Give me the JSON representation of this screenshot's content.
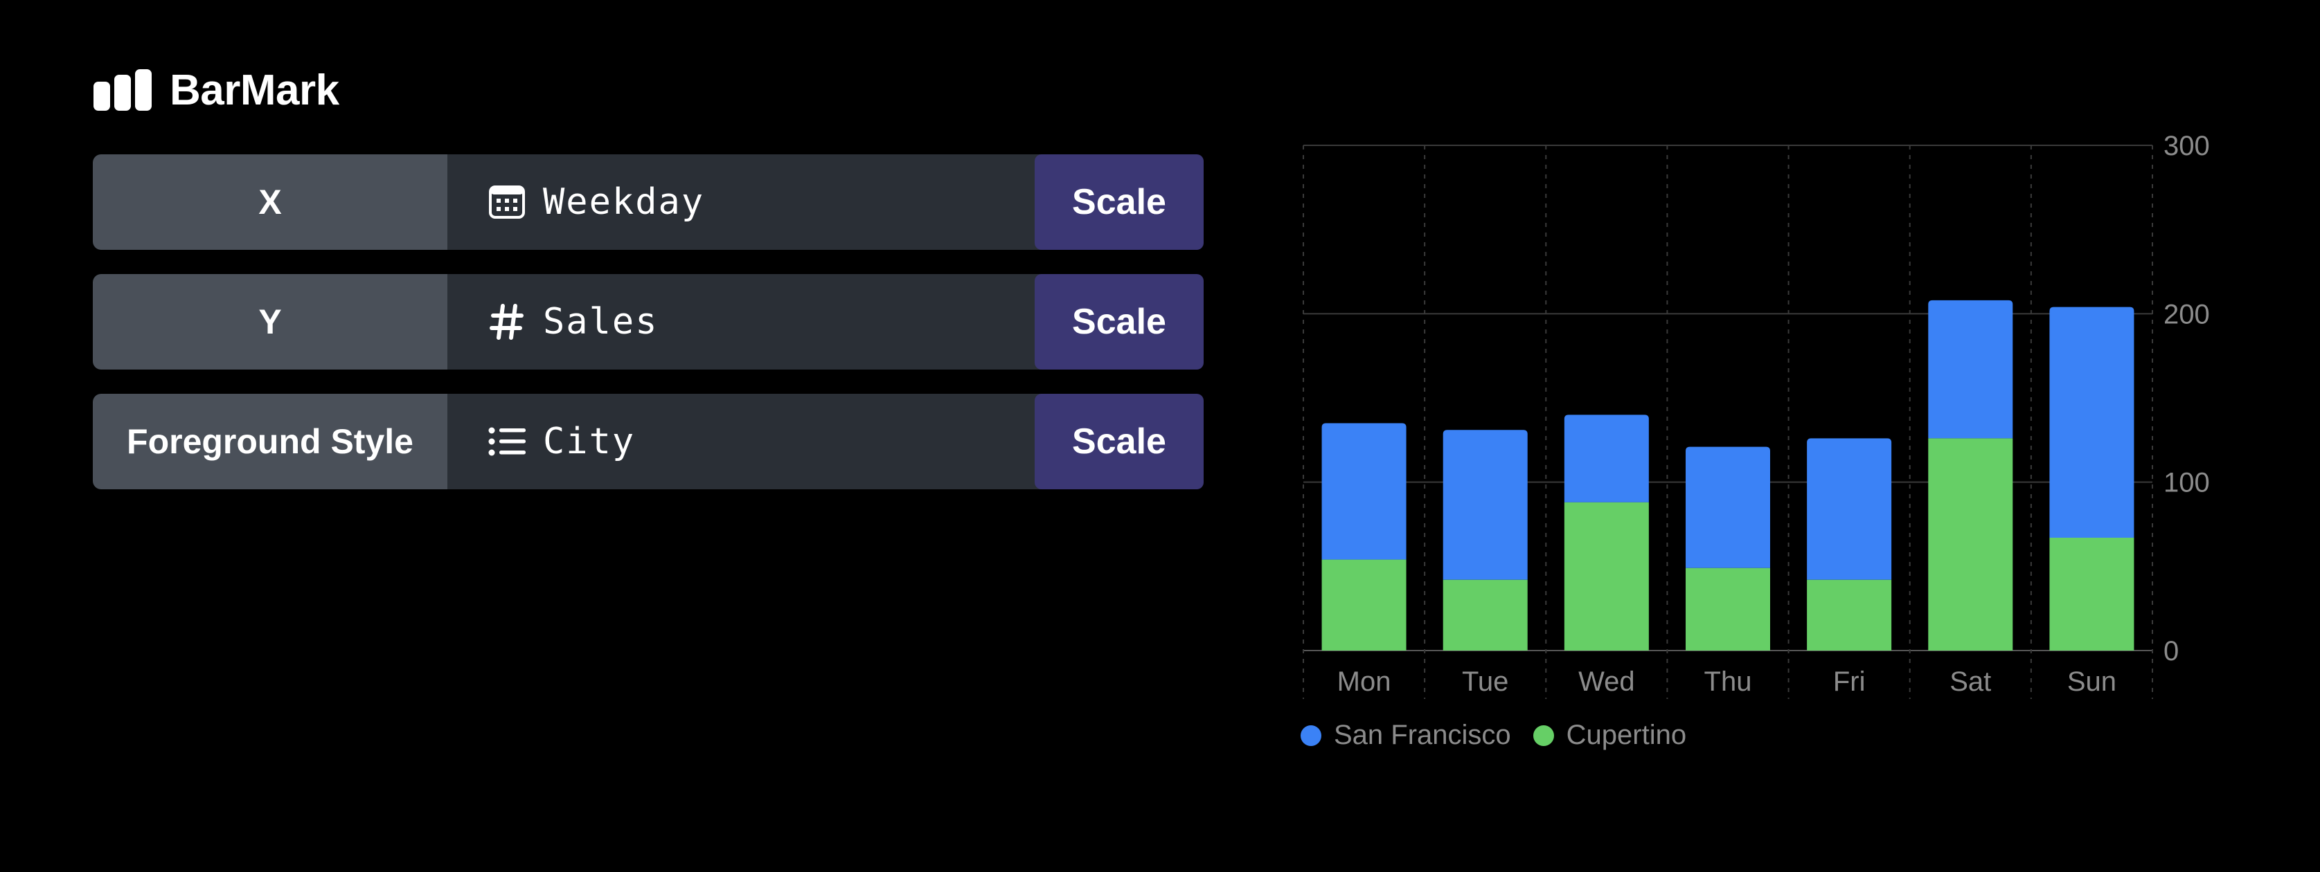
{
  "header": {
    "title": "BarMark",
    "icon": "bar-chart-icon"
  },
  "encodings": [
    {
      "label": "X",
      "field": "Weekday",
      "field_icon": "calendar-icon",
      "button": "Scale"
    },
    {
      "label": "Y",
      "field": "Sales",
      "field_icon": "number-sign-icon",
      "button": "Scale"
    },
    {
      "label": "Foreground Style",
      "field": "City",
      "field_icon": "list-icon",
      "button": "Scale"
    }
  ],
  "colors": {
    "san_francisco": "#3b82f6",
    "cupertino": "#66cf66",
    "axis_text": "#8c8c8c",
    "grid": "#3a3a3a",
    "button": "#3b3774"
  },
  "chart_data": {
    "type": "bar",
    "stacked": true,
    "categories": [
      "Mon",
      "Tue",
      "Wed",
      "Thu",
      "Fri",
      "Sat",
      "Sun"
    ],
    "series": [
      {
        "name": "Cupertino",
        "values": [
          54,
          42,
          88,
          49,
          42,
          126,
          67
        ]
      },
      {
        "name": "San Francisco",
        "values": [
          81,
          89,
          52,
          72,
          84,
          82,
          137
        ]
      }
    ],
    "ylim": [
      0,
      300
    ],
    "yticks": [
      0,
      100,
      200,
      300
    ],
    "y_axis_position": "right",
    "grid": true,
    "legend": [
      "San Francisco",
      "Cupertino"
    ],
    "legend_position": "bottom-left"
  }
}
